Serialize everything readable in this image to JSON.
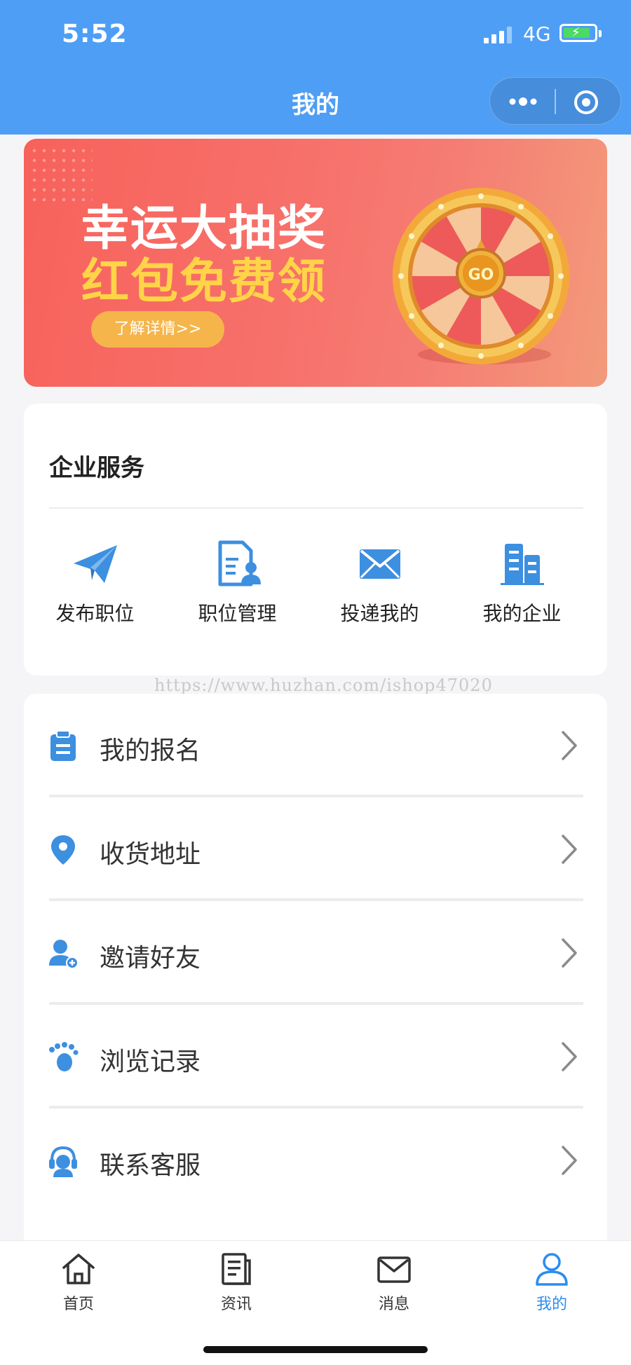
{
  "status_bar": {
    "time": "5:52",
    "network": "4G"
  },
  "header": {
    "title": "我的"
  },
  "banner": {
    "line1": "幸运大抽奖",
    "line2": "红包免费领",
    "cta": "了解详情>>",
    "wheel_label": "GO"
  },
  "enterprise": {
    "title": "企业服务",
    "items": [
      {
        "label": "发布职位",
        "icon": "paper-plane-icon"
      },
      {
        "label": "职位管理",
        "icon": "document-user-icon"
      },
      {
        "label": "投递我的",
        "icon": "envelope-icon"
      },
      {
        "label": "我的企业",
        "icon": "building-icon"
      }
    ]
  },
  "watermark": "https://www.huzhan.com/ishop47020",
  "menu": {
    "items": [
      {
        "label": "我的报名",
        "icon": "clipboard-icon"
      },
      {
        "label": "收货地址",
        "icon": "location-pin-icon"
      },
      {
        "label": "邀请好友",
        "icon": "add-user-icon"
      },
      {
        "label": "浏览记录",
        "icon": "footprint-icon"
      },
      {
        "label": "联系客服",
        "icon": "customer-service-icon"
      }
    ]
  },
  "tabbar": {
    "items": [
      {
        "label": "首页",
        "icon": "home-icon"
      },
      {
        "label": "资讯",
        "icon": "news-icon"
      },
      {
        "label": "消息",
        "icon": "mail-icon"
      },
      {
        "label": "我的",
        "icon": "profile-icon",
        "active": true
      }
    ]
  },
  "colors": {
    "header": "#4e9ef5",
    "accent": "#2a8df0",
    "icon_blue": "#3d8fe0",
    "banner_red": "#f7625b",
    "banner_yellow": "#ffd447"
  }
}
